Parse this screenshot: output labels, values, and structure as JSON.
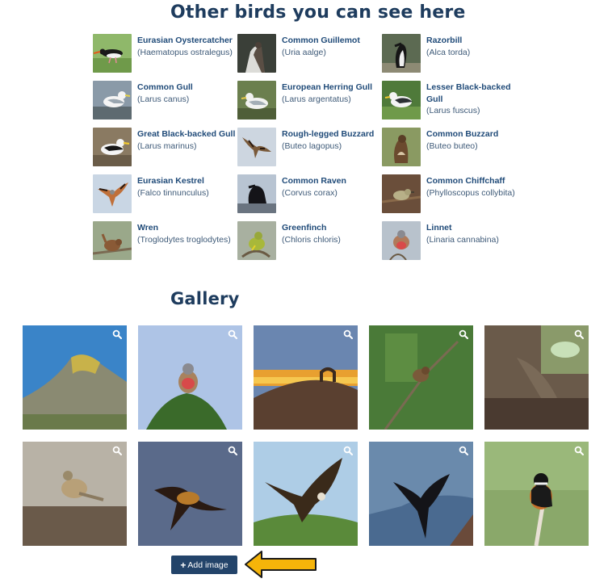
{
  "birds_section": {
    "title": "Other birds you can see here"
  },
  "birds": [
    {
      "name": "Eurasian Oystercatcher",
      "latin": "(Haematopus ostralegus)"
    },
    {
      "name": "Common Guillemot",
      "latin": "(Uria aalge)"
    },
    {
      "name": "Razorbill",
      "latin": "(Alca torda)"
    },
    {
      "name": "Common Gull",
      "latin": "(Larus canus)"
    },
    {
      "name": "European Herring Gull",
      "latin": "(Larus argentatus)"
    },
    {
      "name": "Lesser Black-backed Gull",
      "latin": "(Larus fuscus)"
    },
    {
      "name": "Great Black-backed Gull",
      "latin": "(Larus marinus)"
    },
    {
      "name": "Rough-legged Buzzard",
      "latin": "(Buteo lagopus)"
    },
    {
      "name": "Common Buzzard",
      "latin": "(Buteo buteo)"
    },
    {
      "name": "Eurasian Kestrel",
      "latin": "(Falco tinnunculus)"
    },
    {
      "name": "Common Raven",
      "latin": "(Corvus corax)"
    },
    {
      "name": "Common Chiffchaff",
      "latin": "(Phylloscopus collybita)"
    },
    {
      "name": "Wren",
      "latin": "(Troglodytes troglodytes)"
    },
    {
      "name": "Greenfinch",
      "latin": "(Chloris chloris)"
    },
    {
      "name": "Linnet",
      "latin": "(Linaria cannabina)"
    }
  ],
  "gallery": {
    "title": "Gallery",
    "photo_count": 10,
    "zoom_icon": "search-icon",
    "add_label": "Add image",
    "add_icon": "plus-icon"
  },
  "colors": {
    "heading": "#1e3c5e",
    "link": "#1f4a78",
    "button": "#23446a",
    "arrow": "#f5b40a"
  }
}
